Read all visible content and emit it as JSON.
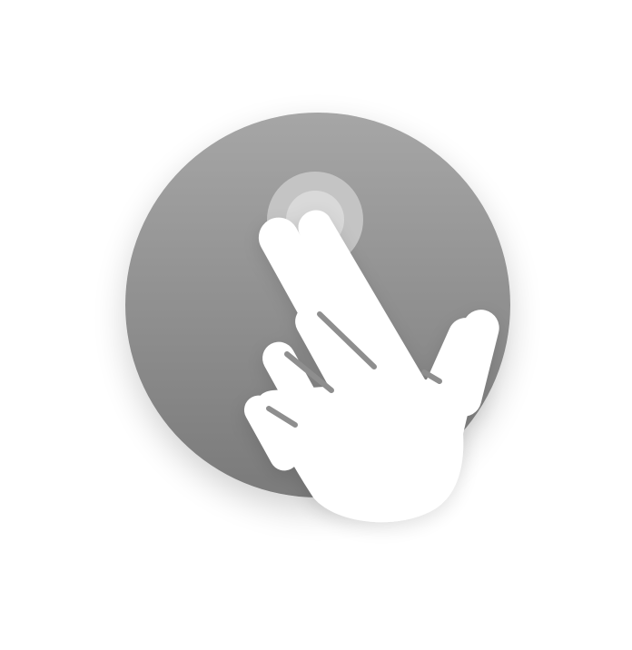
{
  "icon": {
    "name": "tap-gesture-icon",
    "colors": {
      "background": "#ffffff",
      "circle_top": "#a6a6a6",
      "circle_bottom": "#7a7a7a",
      "hand": "#ffffff",
      "ripple_outer": "#c4c4c4",
      "ripple_inner": "#d9d9d9",
      "shadow": "#000000"
    }
  }
}
